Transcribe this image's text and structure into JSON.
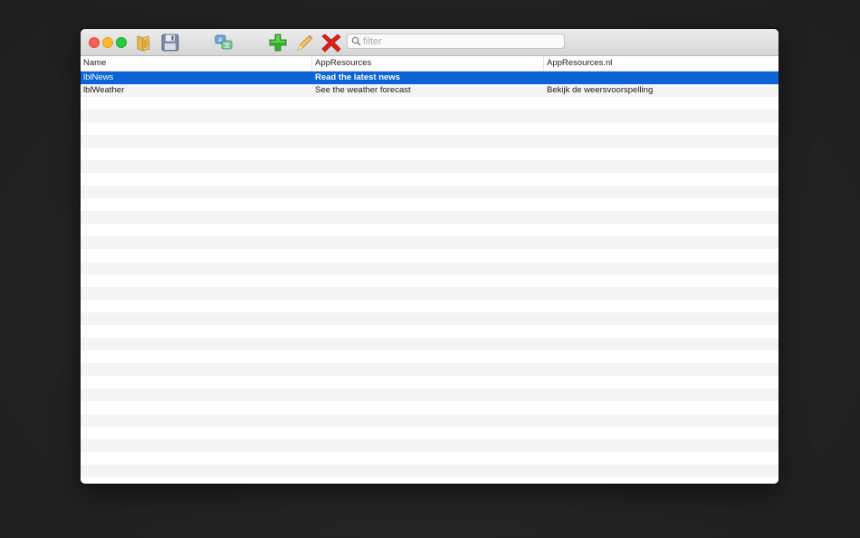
{
  "toolbar": {
    "icons": [
      "open-icon",
      "save-icon",
      "translate-icon",
      "add-icon",
      "edit-icon",
      "delete-icon"
    ],
    "filter_placeholder": "filter",
    "filter_value": ""
  },
  "table": {
    "columns": [
      "Name",
      "AppResources",
      "AppResources.nl"
    ],
    "rows": [
      {
        "cells": [
          "lblNews",
          "Read the latest news",
          ""
        ],
        "selected": true
      },
      {
        "cells": [
          "lblWeather",
          "See the weather forecast",
          "Bekijk de weersvoorspelling"
        ],
        "selected": false
      }
    ]
  },
  "colors": {
    "selection": "#0a64d7",
    "stripe": "#f4f4f5"
  }
}
